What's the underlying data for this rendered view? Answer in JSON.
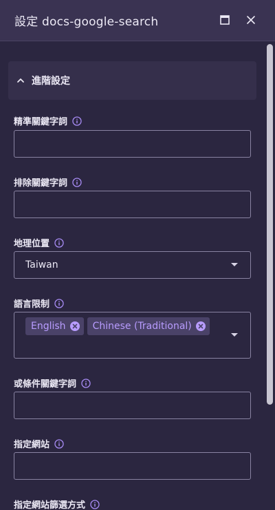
{
  "window": {
    "title": "設定 docs-google-search",
    "maximize_icon": "maximize-icon",
    "close_icon": "close-icon"
  },
  "section": {
    "label": "進階設定",
    "icon": "chevron-up-icon",
    "expanded": true
  },
  "fields": {
    "exact_keywords": {
      "label": "精準關鍵字詞",
      "value": ""
    },
    "exclude_keywords": {
      "label": "排除關鍵字詞",
      "value": ""
    },
    "location": {
      "label": "地理位置",
      "value": "Taiwan"
    },
    "language": {
      "label": "語言限制",
      "chips": [
        "English",
        "Chinese (Traditional)"
      ]
    },
    "or_keywords": {
      "label": "或條件關鍵字詞",
      "value": ""
    },
    "site": {
      "label": "指定網站",
      "value": ""
    },
    "site_filter": {
      "label": "指定網站篩選方式"
    }
  },
  "colors": {
    "background": "#2b2640",
    "titlebar": "#3a3352",
    "accent": "#b89cff",
    "chip_bg": "#4a4268",
    "border": "#8a84a3"
  }
}
